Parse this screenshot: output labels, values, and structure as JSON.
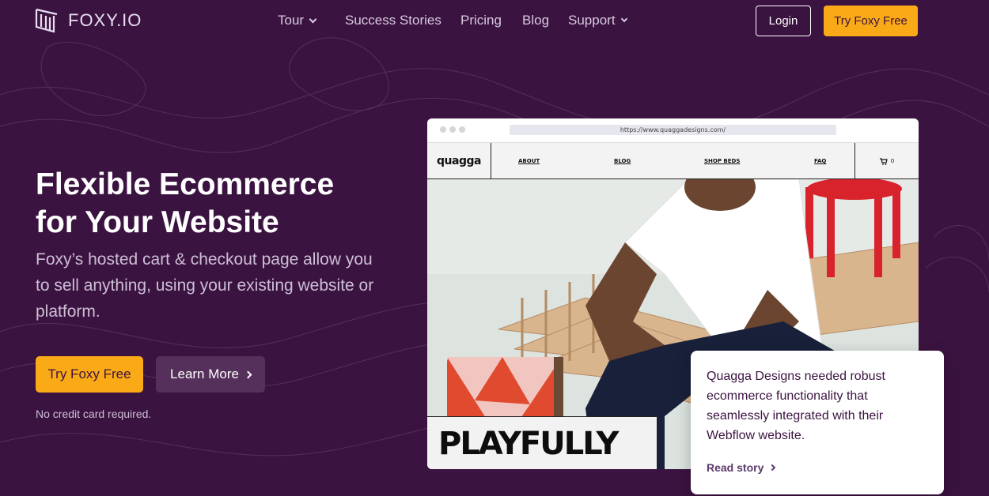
{
  "nav": {
    "logo_text": "FOXY.IO",
    "links": [
      {
        "label": "Tour",
        "has_dropdown": true
      },
      {
        "label": "Success Stories",
        "has_dropdown": false
      },
      {
        "label": "Pricing",
        "has_dropdown": false
      },
      {
        "label": "Blog",
        "has_dropdown": false
      },
      {
        "label": "Support",
        "has_dropdown": true
      }
    ],
    "login_label": "Login",
    "try_label": "Try Foxy Free"
  },
  "hero": {
    "title_line1": "Flexible Ecommerce",
    "title_line2": "for Your Website",
    "subtitle": "Foxy’s hosted cart & checkout page allow you to sell anything, using your existing website or platform.",
    "primary_cta": "Try Foxy Free",
    "secondary_cta": "Learn More",
    "note": "No credit card required."
  },
  "mockup": {
    "url": "https://www.quaggadesigns.com/",
    "site_logo": "quagga",
    "site_links": [
      "ABOUT",
      "BLOG",
      "SHOP BEDS",
      "FAQ"
    ],
    "cart_count": "0",
    "banner_text": "PLAYFULLY"
  },
  "card": {
    "text": "Quagga Designs needed robust ecommerce functionality that seamlessly integrated with their Webflow website.",
    "link_label": "Read story"
  },
  "colors": {
    "background": "#3b1340",
    "accent": "#fbaa17",
    "secondary_button": "#55305a"
  }
}
